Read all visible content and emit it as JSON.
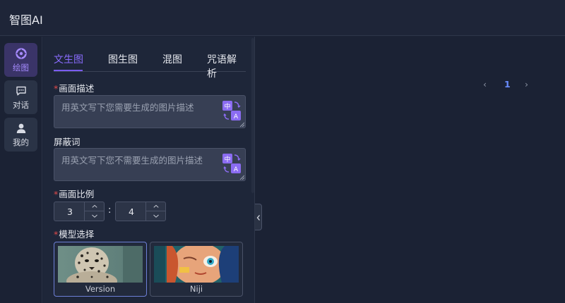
{
  "app": {
    "title": "智图AI"
  },
  "nav": {
    "items": [
      {
        "label": "绘图",
        "icon": "palette-icon",
        "active": true
      },
      {
        "label": "对话",
        "icon": "chat-icon",
        "active": false
      },
      {
        "label": "我的",
        "icon": "user-icon",
        "active": false
      }
    ]
  },
  "tabs": [
    {
      "label": "文生图",
      "active": true
    },
    {
      "label": "图生图",
      "active": false
    },
    {
      "label": "混图",
      "active": false
    },
    {
      "label": "咒语解析",
      "active": false
    }
  ],
  "form": {
    "prompt": {
      "label": "画面描述",
      "required": true,
      "value": "",
      "placeholder": "用英文写下您需要生成的图片描述"
    },
    "negative": {
      "label": "屏蔽词",
      "required": false,
      "value": "",
      "placeholder": "用英文写下您不需要生成的图片描述"
    },
    "aspect": {
      "label": "画面比例",
      "required": true,
      "width": "3",
      "height": "4",
      "separator": ":"
    },
    "model": {
      "label": "模型选择",
      "required": true,
      "options": [
        {
          "name": "Version",
          "selected": true
        },
        {
          "name": "Niji",
          "selected": false
        }
      ]
    }
  },
  "pagination": {
    "prev": "‹",
    "current": "1",
    "next": "›"
  },
  "colors": {
    "accent": "#7a5cf0",
    "active_nav_bg": "#3a3468",
    "required": "#e04b4b",
    "page_current": "#6a8dff"
  }
}
